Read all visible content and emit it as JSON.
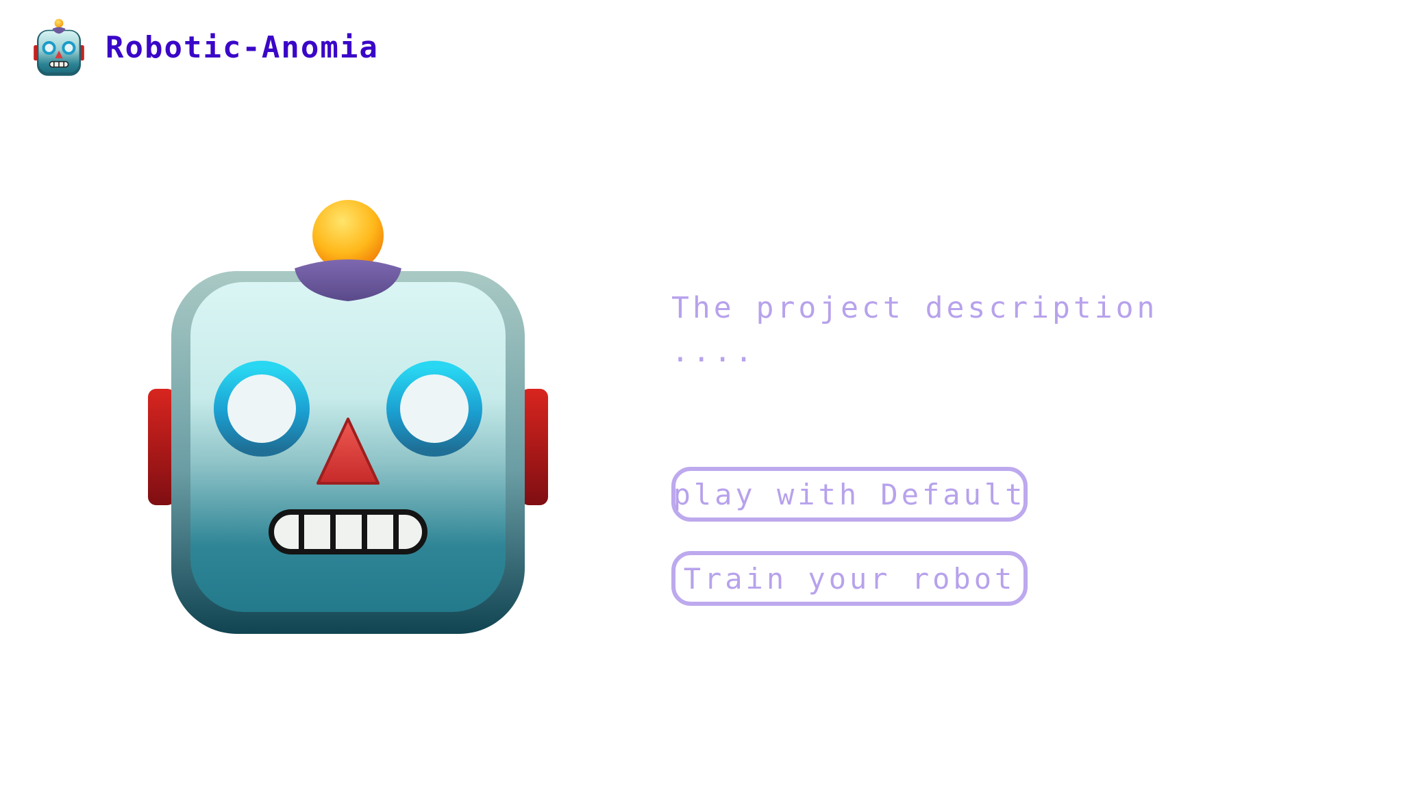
{
  "header": {
    "logo_icon": "robot-face-icon",
    "title": "Robotic-Anomia"
  },
  "hero": {
    "image_icon": "robot-face-icon"
  },
  "main": {
    "description": "The project description",
    "description_more": "...."
  },
  "actions": {
    "play_default_label": "play with Default",
    "train_label": "Train your robot"
  },
  "colors": {
    "title": "#3a06c8",
    "accent": "#b7a2ec",
    "button_border": "#bda9ee",
    "background": "#ffffff"
  }
}
